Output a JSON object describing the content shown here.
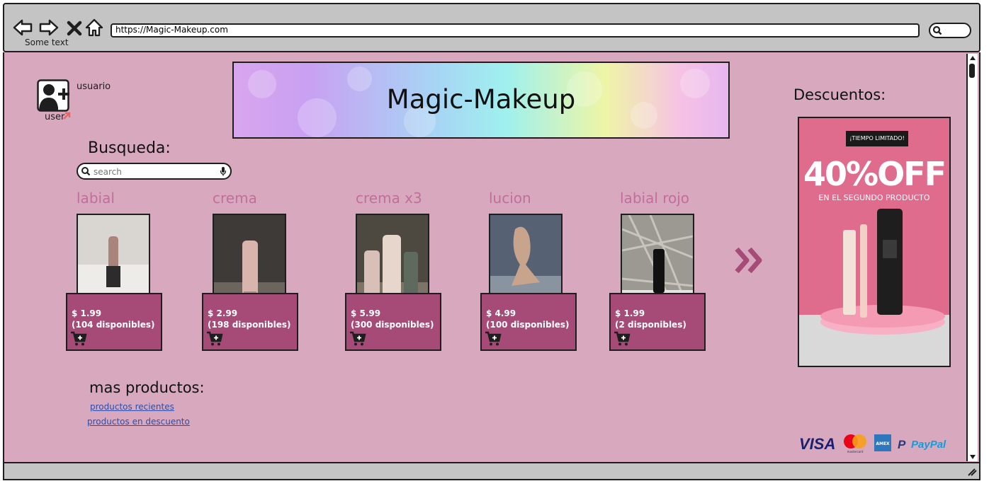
{
  "browser": {
    "url": "https://Magic-Makeup.com",
    "status_text": "Some text"
  },
  "user": {
    "name_label": "usuario",
    "icon_label": "user"
  },
  "banner": {
    "title": "Magic-Makeup"
  },
  "search": {
    "label": "Busqueda:",
    "placeholder": "search"
  },
  "products": [
    {
      "name": "labial",
      "price": "$ 1.99",
      "availability": "(104 disponibles)"
    },
    {
      "name": "crema",
      "price": "$ 2.99",
      "availability": "(198 disponibles)"
    },
    {
      "name": "crema x3",
      "price": "$ 5.99",
      "availability": "(300 disponibles)"
    },
    {
      "name": "lucion",
      "price": "$ 4.99",
      "availability": "(100 disponibles)"
    },
    {
      "name": "labial rojo",
      "price": "$ 1.99",
      "availability": "(2 disponibles)"
    }
  ],
  "discounts": {
    "label": "Descuentos:",
    "badge": "¡TIEMPO LIMITADO!",
    "headline": "40%OFF",
    "subline": "EN EL SEGUNDO PRODUCTO"
  },
  "more": {
    "label": "mas productos:",
    "links": [
      "productos recientes",
      "productos en descuento"
    ]
  },
  "payments": {
    "methods": [
      "VISA",
      "mastercard",
      "AMEX",
      "PayPal"
    ]
  },
  "colors": {
    "page_bg": "#d8a8bf",
    "card_bg": "#a64b78",
    "product_name": "#c06f98",
    "promo_bg": "#df6b8d"
  }
}
